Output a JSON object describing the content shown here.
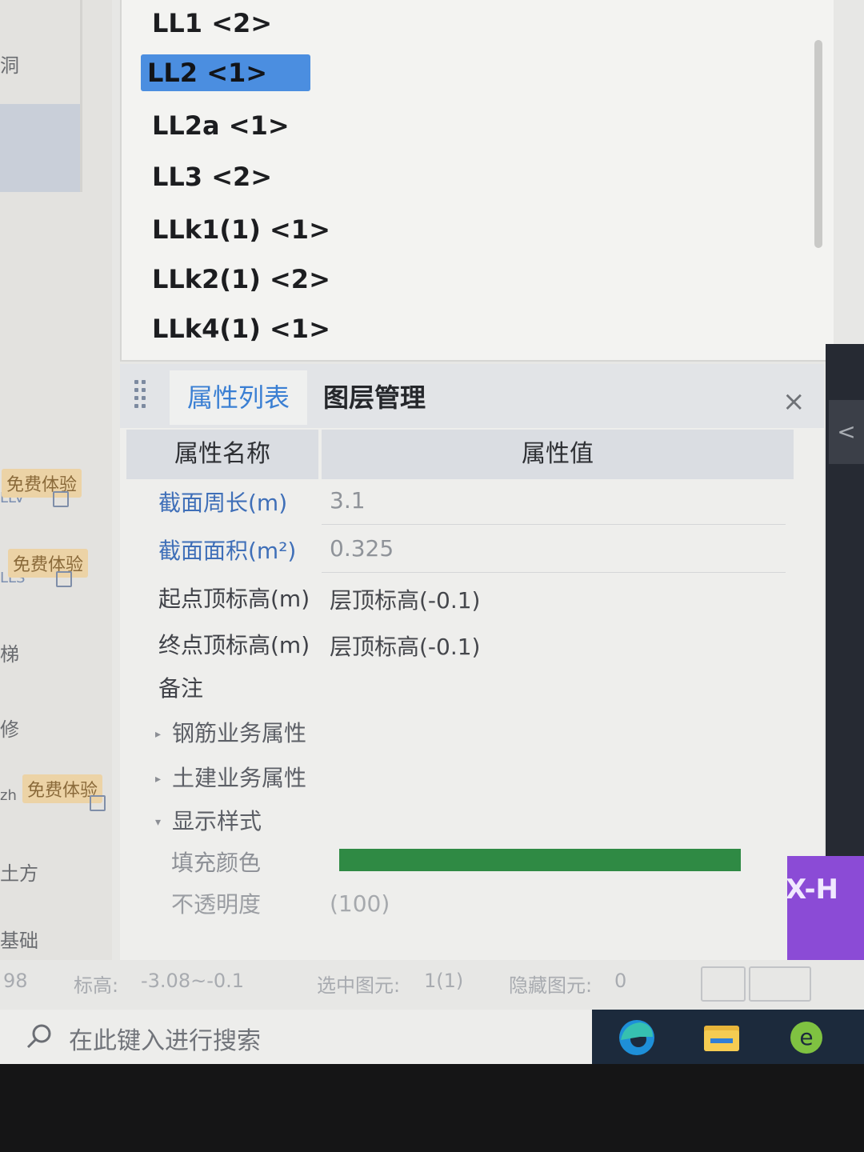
{
  "left_sidebar": {
    "items": [
      "洞",
      "梯",
      "修",
      "土方",
      "基础"
    ],
    "badges": [
      "免费体验",
      "免费体验",
      "免费体验"
    ],
    "fragments": [
      "LLV",
      "LLS",
      "zh"
    ]
  },
  "component_list": {
    "items": [
      {
        "label": "LL1 <2>",
        "selected": false
      },
      {
        "label": "LL2 <1>",
        "selected": true
      },
      {
        "label": "LL2a <1>",
        "selected": false
      },
      {
        "label": "LL3 <2>",
        "selected": false
      },
      {
        "label": "LLk1(1) <1>",
        "selected": false
      },
      {
        "label": "LLk2(1) <2>",
        "selected": false
      },
      {
        "label": "LLk4(1) <1>",
        "selected": false
      }
    ]
  },
  "properties": {
    "tabs": {
      "active": "属性列表",
      "inactive": "图层管理"
    },
    "close": "×",
    "columns": {
      "name": "属性名称",
      "value": "属性值"
    },
    "rows": [
      {
        "name": "截面周长(m)",
        "value": "3.1"
      },
      {
        "name": "截面面积(m²)",
        "value": "0.325"
      },
      {
        "name": "起点顶标高(m)",
        "value": "层顶标高(-0.1)"
      },
      {
        "name": "终点顶标高(m)",
        "value": "层顶标高(-0.1)"
      },
      {
        "name": "备注",
        "value": ""
      }
    ],
    "groups": [
      "钢筋业务属性",
      "土建业务属性",
      "显示样式"
    ],
    "fill_color_label": "填充颜色",
    "fill_color": "#2f8a44",
    "opacity_label": "不透明度",
    "opacity_value": "(100)"
  },
  "status_bar": {
    "left_number": "98",
    "elevation_label": "标高:",
    "elevation_value": "-3.08~-0.1",
    "selected_label": "选中图元:",
    "selected_value": "1(1)",
    "hidden_label": "隐藏图元:",
    "hidden_value": "0"
  },
  "right_panel": {
    "collapse_glyph": "<",
    "label": "X-H"
  },
  "taskbar": {
    "search_placeholder": "在此键入进行搜索"
  }
}
